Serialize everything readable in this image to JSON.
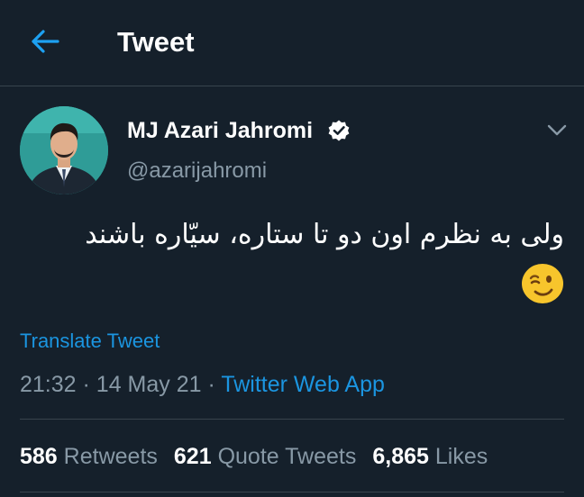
{
  "header": {
    "title": "Tweet",
    "back_icon": "arrow-left-icon",
    "accent_color": "#1da1f2"
  },
  "author": {
    "name": "MJ Azari Jahromi",
    "handle": "@azarijahromi",
    "verified_icon": "verified-badge-icon"
  },
  "tweet": {
    "text": "ولی به نظرم اون دو تا ستاره، سیّاره باشند",
    "emoji": "winking-face-icon",
    "translate_label": "Translate Tweet",
    "time": "21:32",
    "date": "14 May 21",
    "separator": "·",
    "source": "Twitter Web App"
  },
  "stats": {
    "retweets_count": "586",
    "retweets_label": "Retweets",
    "quotes_count": "621",
    "quotes_label": "Quote Tweets",
    "likes_count": "6,865",
    "likes_label": "Likes"
  },
  "colors": {
    "background": "#15202b",
    "link": "#1b95e0",
    "secondary_text": "#8899a6",
    "border": "#38444d"
  }
}
